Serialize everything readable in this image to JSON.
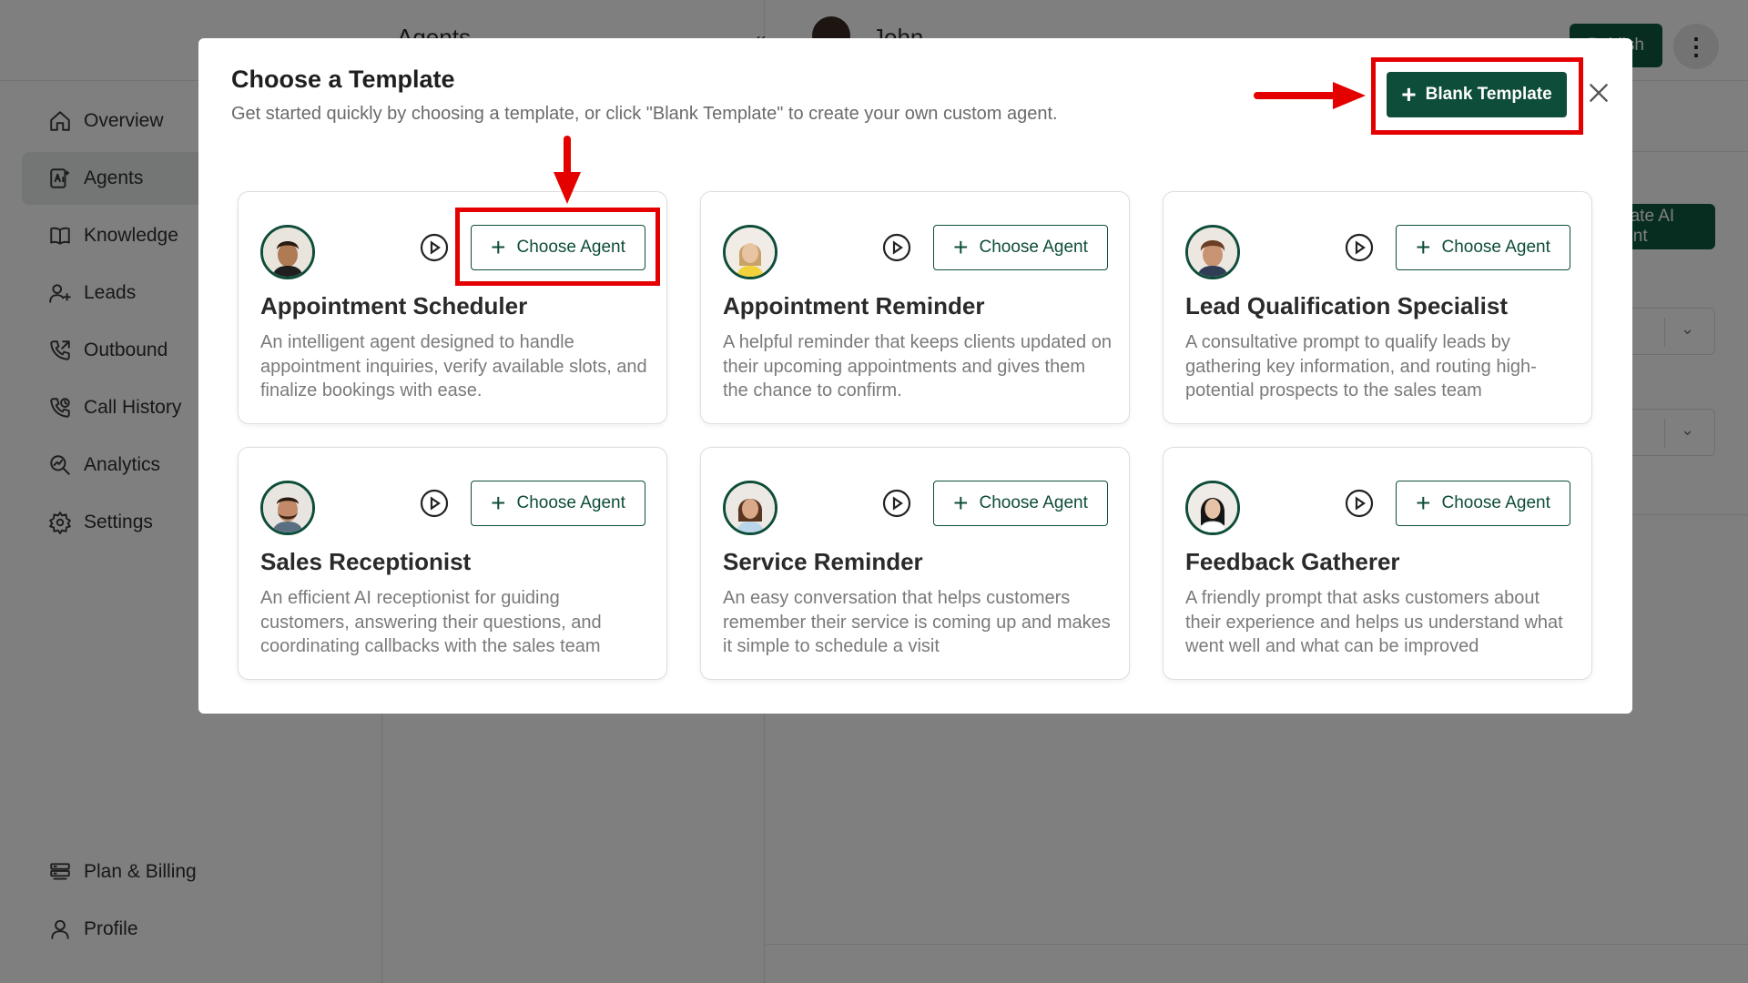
{
  "sidebar": {
    "items": [
      {
        "label": "Overview",
        "icon": "home-icon",
        "active": false
      },
      {
        "label": "Agents",
        "icon": "ai-agent-icon",
        "active": true
      },
      {
        "label": "Knowledge",
        "icon": "book-icon",
        "active": false
      },
      {
        "label": "Leads",
        "icon": "user-plus-icon",
        "active": false
      },
      {
        "label": "Outbound",
        "icon": "phone-outgoing-icon",
        "active": false
      },
      {
        "label": "Call History",
        "icon": "phone-history-icon",
        "active": false
      },
      {
        "label": "Analytics",
        "icon": "analytics-icon",
        "active": false
      },
      {
        "label": "Settings",
        "icon": "gear-icon",
        "active": false
      }
    ],
    "bottom_items": [
      {
        "label": "Plan & Billing",
        "icon": "billing-icon"
      },
      {
        "label": "Profile",
        "icon": "user-icon"
      }
    ]
  },
  "header": {
    "agents_title": "Agents",
    "user_name": "John",
    "publish_label": "Publish",
    "create_agent_label": "Create AI Agent"
  },
  "modal": {
    "title": "Choose a Template",
    "subtitle": "Get started quickly by choosing a template, or click \"Blank Template\" to create your own custom agent.",
    "blank_template_label": "Blank Template",
    "choose_label": "Choose Agent",
    "templates": [
      {
        "title": "Appointment Scheduler",
        "description": "An intelligent agent designed to handle appointment inquiries, verify available slots, and finalize bookings with ease.",
        "avatar": "man-dark-hair-avatar"
      },
      {
        "title": "Appointment Reminder",
        "description": "A helpful reminder that keeps clients updated on their upcoming appointments and gives them the chance to confirm.",
        "avatar": "woman-yellow-top-avatar"
      },
      {
        "title": "Lead Qualification Specialist",
        "description": "A consultative prompt to qualify leads by gathering key information, and routing high-potential prospects to the sales team",
        "avatar": "man-curly-hair-avatar"
      },
      {
        "title": "Sales Receptionist",
        "description": "An efficient AI receptionist for guiding customers, answering their questions, and coordinating callbacks with the sales team",
        "avatar": "man-beard-avatar"
      },
      {
        "title": "Service Reminder",
        "description": "An easy conversation that helps customers remember their service is coming up and makes it simple to schedule a visit",
        "avatar": "woman-brown-hair-avatar"
      },
      {
        "title": "Feedback Gatherer",
        "description": "A friendly prompt that asks customers about their experience and helps us understand what went well and what can be improved",
        "avatar": "woman-black-hair-avatar"
      }
    ]
  },
  "colors": {
    "brand_green": "#0e4d39",
    "annotation_red": "#e50000",
    "active_nav_bg": "#e7ece9"
  }
}
